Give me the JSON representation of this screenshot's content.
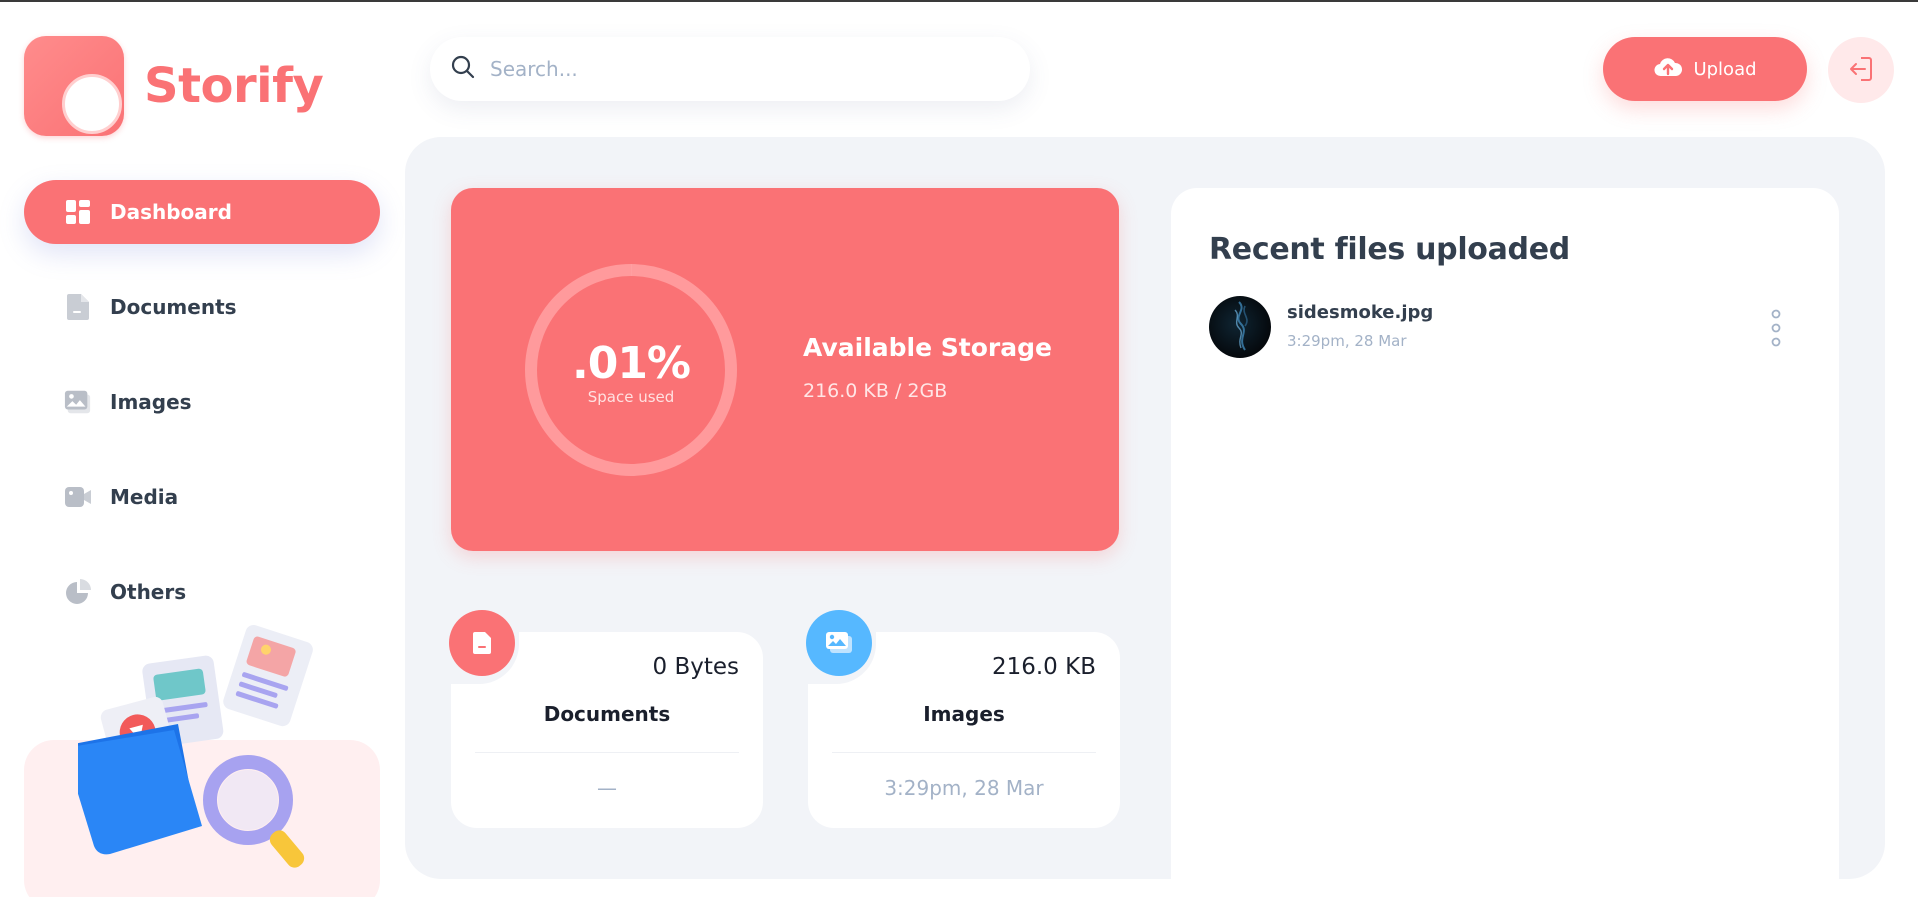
{
  "brand": {
    "name": "Storify",
    "accent": "#FA7275"
  },
  "search": {
    "placeholder": "Search..."
  },
  "header": {
    "upload_label": "Upload"
  },
  "sidebar": {
    "items": [
      {
        "label": "Dashboard",
        "icon": "dashboard-icon",
        "active": true
      },
      {
        "label": "Documents",
        "icon": "documents-icon",
        "active": false
      },
      {
        "label": "Images",
        "icon": "images-icon",
        "active": false
      },
      {
        "label": "Media",
        "icon": "video-icon",
        "active": false
      },
      {
        "label": "Others",
        "icon": "pie-chart-icon",
        "active": false
      }
    ]
  },
  "storage": {
    "percent_label": ".01%",
    "percent_value": 0.01,
    "sub_label": "Space used",
    "title": "Available Storage",
    "value": "216.0 KB / 2GB"
  },
  "summary": [
    {
      "title": "Documents",
      "size": "0 Bytes",
      "date": "—",
      "icon": "document-icon",
      "color": "#FA7275"
    },
    {
      "title": "Images",
      "size": "216.0 KB",
      "date": "3:29pm, 28 Mar",
      "icon": "image-icon",
      "color": "#56B8FF"
    }
  ],
  "recent": {
    "title": "Recent files uploaded",
    "files": [
      {
        "name": "sidesmoke.jpg",
        "date": "3:29pm, 28 Mar",
        "icon": "more-vertical-icon"
      }
    ]
  }
}
